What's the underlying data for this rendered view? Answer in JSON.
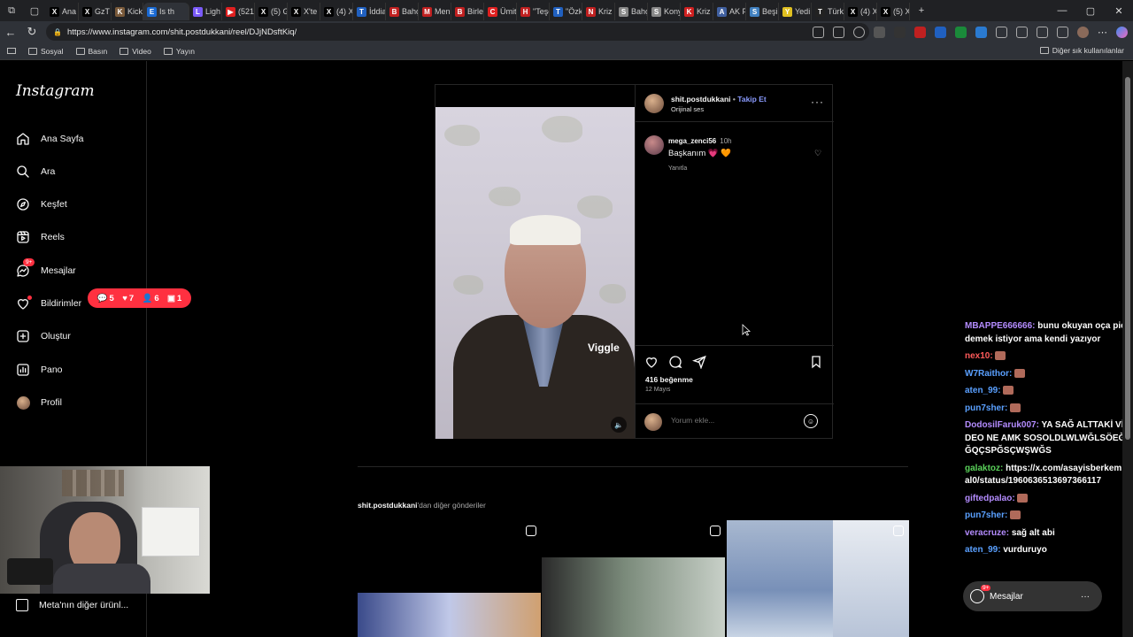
{
  "browser": {
    "tabs": [
      {
        "label": "Ana",
        "fav": "X",
        "color": "#000000"
      },
      {
        "label": "GzT",
        "fav": "X",
        "color": "#000000"
      },
      {
        "label": "Kick",
        "fav": "K",
        "color": "#7a5a3a"
      },
      {
        "label": "Is th",
        "fav": "E",
        "color": "#1a6ad4"
      },
      {
        "label": "Ligh",
        "fav": "L",
        "color": "#7a5af8"
      },
      {
        "label": "(521",
        "fav": "▶",
        "color": "#e02020"
      },
      {
        "label": "(5) G",
        "fav": "X",
        "color": "#000000"
      },
      {
        "label": "X'te",
        "fav": "X",
        "color": "#000000"
      },
      {
        "label": "(4) X",
        "fav": "X",
        "color": "#000000"
      },
      {
        "label": "İddia",
        "fav": "T",
        "color": "#2060c0"
      },
      {
        "label": "Bahç",
        "fav": "B",
        "color": "#c02020"
      },
      {
        "label": "Men",
        "fav": "M",
        "color": "#c02020"
      },
      {
        "label": "Birle",
        "fav": "B",
        "color": "#c02020"
      },
      {
        "label": "Ümit",
        "fav": "C",
        "color": "#e02020"
      },
      {
        "label": "\"Teşe",
        "fav": "H",
        "color": "#c02020"
      },
      {
        "label": "\"Özk",
        "fav": "T",
        "color": "#2060c0"
      },
      {
        "label": "Kriz",
        "fav": "N",
        "color": "#c02020"
      },
      {
        "label": "Bahç",
        "fav": "S",
        "color": "#888888"
      },
      {
        "label": "Kony",
        "fav": "S",
        "color": "#888888"
      },
      {
        "label": "Kriz",
        "fav": "K",
        "color": "#d02020"
      },
      {
        "label": "AK P",
        "fav": "A",
        "color": "#4060a0"
      },
      {
        "label": "Beşik",
        "fav": "S",
        "color": "#4080c0"
      },
      {
        "label": "Yedi",
        "fav": "Y",
        "color": "#e0c020"
      },
      {
        "label": "Türk",
        "fav": "T",
        "color": "#222222"
      },
      {
        "label": "(4) X",
        "fav": "X",
        "color": "#000000"
      },
      {
        "label": "(5) X",
        "fav": "X",
        "color": "#000000"
      }
    ],
    "url": "https://www.instagram.com/shit.postdukkani/reel/DJjNDsftKiq/",
    "bookmarks": [
      "Sosyal",
      "Basın",
      "Video",
      "Yayın"
    ],
    "bookmarks_other": "Diğer sık kullanılanlar"
  },
  "sidebar": {
    "logo": "Instagram",
    "items": [
      {
        "label": "Ana Sayfa",
        "icon": "home-icon"
      },
      {
        "label": "Ara",
        "icon": "search-icon"
      },
      {
        "label": "Keşfet",
        "icon": "compass-icon"
      },
      {
        "label": "Reels",
        "icon": "reels-icon"
      },
      {
        "label": "Mesajlar",
        "icon": "messenger-icon"
      },
      {
        "label": "Bildirimler",
        "icon": "heart-icon"
      },
      {
        "label": "Oluştur",
        "icon": "plus-square-icon"
      },
      {
        "label": "Pano",
        "icon": "dashboard-icon"
      },
      {
        "label": "Profil",
        "icon": "avatar-icon"
      }
    ],
    "messages_badge": "9+",
    "meta_more": "Meta'nın diğer ürünl..."
  },
  "notifications": {
    "comments": "5",
    "likes": "7",
    "follows": "6",
    "tags": "1"
  },
  "post": {
    "username": "shit.postdukkani",
    "separator": "•",
    "follow": "Takip Et",
    "audio": "Orijinal ses",
    "video_watermark": "Viggle",
    "comment": {
      "user": "mega_zenci56",
      "time": "10h",
      "text": "Başkanım 💗 🧡",
      "reply": "Yanıtla"
    },
    "likes": "416 beğenme",
    "date": "12 Mayıs",
    "comment_placeholder": "Yorum ekle..."
  },
  "more_posts": {
    "user": "shit.postdukkani",
    "suffix": "'dan diğer gönderiler"
  },
  "chat": [
    {
      "user": "MBAPPE666666:",
      "text": "bunu okuyan oça piç demek istiyor ama kendi yazıyor",
      "color": "#b48cff"
    },
    {
      "user": "nex10:",
      "text": "",
      "color": "#ff5a5a"
    },
    {
      "user": "W7Raithor:",
      "text": "",
      "color": "#5aa0ff"
    },
    {
      "user": "aten_99:",
      "text": "",
      "color": "#5aa0ff"
    },
    {
      "user": "pun7sher:",
      "text": "",
      "color": "#5aa0ff"
    },
    {
      "user": "DodosilFaruk007:",
      "text": "YA SAĞ ALTTAKİ VİDEO NE AMK SOSOLDLWLWĞLSÖEĞĞQÇSPĞSÇWŞWĞS",
      "color": "#b48cff"
    },
    {
      "user": "galaktoz:",
      "text": "https://x.com/asayisberkemal0/status/1960636513697366117",
      "color": "#5ad25a"
    },
    {
      "user": "giftedpalao:",
      "text": "",
      "color": "#b48cff"
    },
    {
      "user": "pun7sher:",
      "text": "",
      "color": "#5aa0ff"
    },
    {
      "user": "veracruze:",
      "text": "sağ alt abi",
      "color": "#b48cff"
    },
    {
      "user": "aten_99:",
      "text": "vurduruyo",
      "color": "#5aa0ff"
    }
  ],
  "floating_messages": {
    "label": "Mesajlar",
    "badge": "9+"
  }
}
